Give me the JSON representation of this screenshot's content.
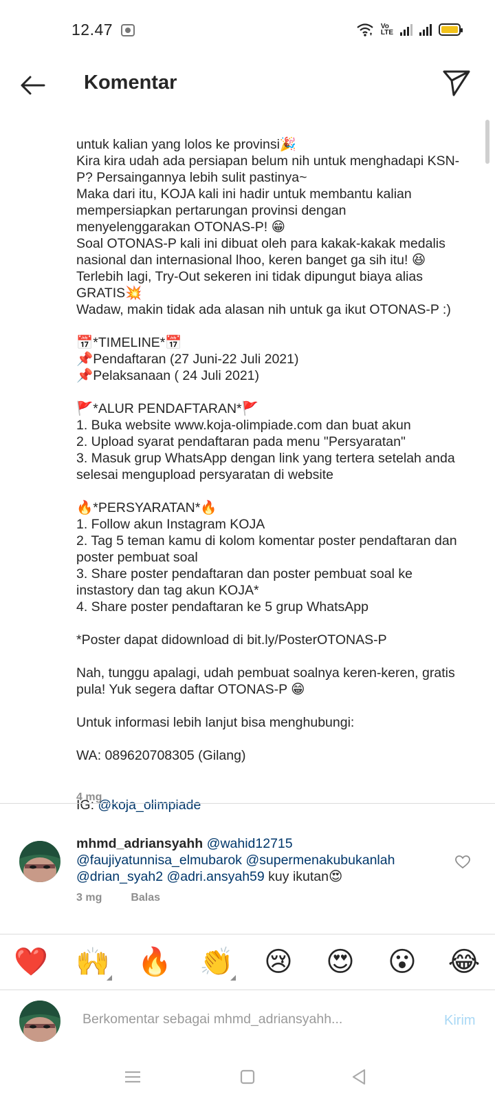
{
  "status_bar": {
    "time": "12.47",
    "volte_label": "Vo\nLTE",
    "icons": [
      "notification-icon",
      "wifi-icon",
      "volte-icon",
      "signal-icon",
      "signal-icon",
      "battery-icon"
    ],
    "battery_color": "#f2c21b"
  },
  "header": {
    "title": "Komentar",
    "back_icon": "arrow-left-icon",
    "share_icon": "send-icon"
  },
  "caption": {
    "lines": [
      "untuk kalian yang lolos ke provinsi🎉",
      "Kira kira udah ada persiapan belum nih untuk menghadapi KSN-P? Persaingannya lebih sulit pastinya~",
      "Maka dari itu, KOJA kali ini hadir untuk membantu kalian mempersiapkan pertarungan provinsi dengan menyelenggarakan OTONAS-P! 😁",
      "Soal OTONAS-P kali ini dibuat oleh para kakak-kakak medalis nasional dan internasional lhoo, keren banget ga sih itu! 😆",
      "Terlebih lagi, Try-Out sekeren ini tidak dipungut biaya alias GRATIS💥",
      "Wadaw, makin tidak ada alasan nih untuk ga ikut OTONAS-P :)",
      "",
      "📅*TIMELINE*📅",
      "📌Pendaftaran (27 Juni-22 Juli 2021)",
      "📌Pelaksanaan ( 24 Juli 2021)",
      "",
      "🚩*ALUR PENDAFTARAN*🚩",
      "1. Buka website www.koja-olimpiade.com dan buat akun",
      "2. Upload syarat pendaftaran pada menu \"Persyaratan\"",
      "3. Masuk grup WhatsApp dengan link yang tertera setelah anda selesai mengupload persyaratan di website",
      "",
      "🔥*PERSYARATAN*🔥",
      "1. Follow akun Instagram KOJA",
      "2. Tag 5 teman kamu di kolom komentar poster pendaftaran dan poster pembuat soal",
      "3. Share poster pendaftaran dan poster pembuat soal ke instastory dan tag akun KOJA*",
      "4. Share poster pendaftaran ke 5 grup WhatsApp",
      "",
      "*Poster dapat didownload di bit.ly/PosterOTONAS-P",
      "",
      "Nah, tunggu apalagi, udah pembuat soalnya keren-keren, gratis pula! Yuk segera daftar OTONAS-P 😁",
      "",
      "Untuk informasi lebih lanjut bisa menghubungi:",
      "",
      "WA: 089620708305 (Gilang)"
    ],
    "ig_prefix": "IG: ",
    "ig_handle": "@koja_olimpiade",
    "time": "4 mg"
  },
  "comment": {
    "username": "mhmd_adriansyahh",
    "mentions": "@wahid12715 @faujiyatunnisa_elmubarok @supermenakubukanlah @drian_syah2 @adri.ansyah59",
    "text": " kuy ikutan😍",
    "time": "3 mg",
    "reply_label": "Balas"
  },
  "emoji_bar": [
    {
      "emoji": "❤️",
      "has_variants": false
    },
    {
      "emoji": "🙌",
      "has_variants": true
    },
    {
      "emoji": "🔥",
      "has_variants": false
    },
    {
      "emoji": "👏",
      "has_variants": true
    },
    {
      "emoji": "😢",
      "has_variants": false
    },
    {
      "emoji": "😍",
      "has_variants": false
    },
    {
      "emoji": "😮",
      "has_variants": false
    },
    {
      "emoji": "😂",
      "has_variants": false
    }
  ],
  "composer": {
    "placeholder": "Berkomentar sebagai mhmd_adriansyahh...",
    "send_label": "Kirim"
  },
  "navbar": {
    "icons": [
      "menu-icon",
      "home-square-icon",
      "back-triangle-icon"
    ]
  }
}
